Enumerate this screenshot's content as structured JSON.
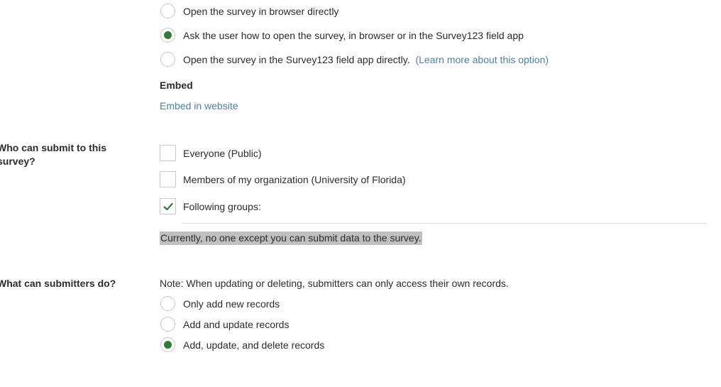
{
  "open_options": [
    {
      "label": "Open the survey in browser directly",
      "selected": false
    },
    {
      "label": "Ask the user how to open the survey, in browser or in the Survey123 field app",
      "selected": true
    },
    {
      "label": "Open the survey in the Survey123 field app directly.",
      "selected": false,
      "link": "(Learn more about this option)"
    }
  ],
  "embed": {
    "heading": "Embed",
    "link": "Embed in website"
  },
  "who_can_submit": {
    "label": "Who can submit to this survey?",
    "label_lines": [
      "Who can submit to this",
      "survey?"
    ],
    "options": [
      {
        "label": "Everyone (Public)",
        "checked": false
      },
      {
        "label": "Members of my organization (University of Florida)",
        "checked": false
      },
      {
        "label": "Following groups:",
        "checked": true
      }
    ],
    "notice": "Currently, no one except you can submit data to the survey."
  },
  "submitters_can_do": {
    "label": "What can submitters do?",
    "note": "Note: When updating or deleting, submitters can only access their own records.",
    "options": [
      {
        "label": "Only add new records",
        "selected": false
      },
      {
        "label": "Add and update records",
        "selected": false
      },
      {
        "label": "Add, update, and delete records",
        "selected": true
      }
    ]
  },
  "colors": {
    "accent_green": "#2e7d32",
    "link_blue": "#4a7fb0",
    "highlight_gray": "#c0c0c0"
  }
}
